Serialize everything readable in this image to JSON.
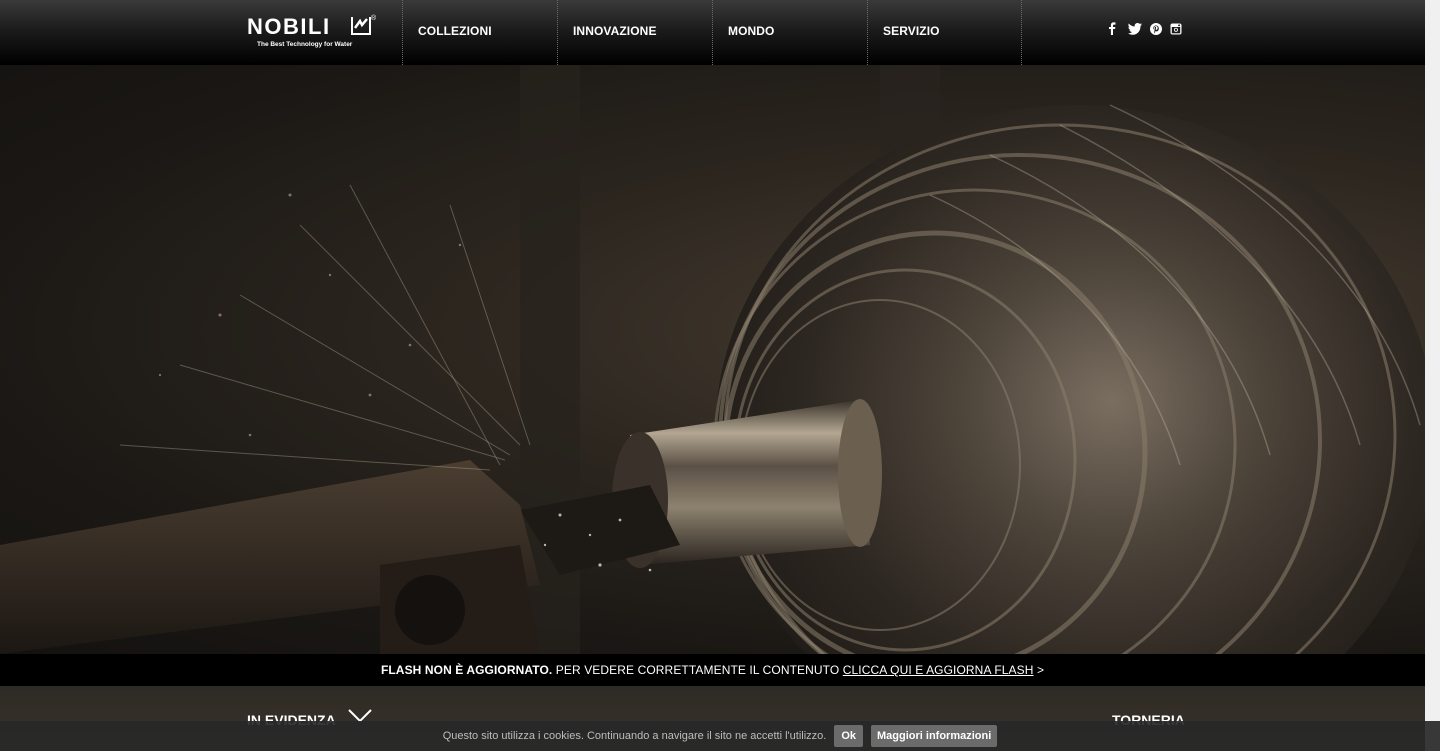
{
  "header": {
    "logo": {
      "wordmark": "NOBILI",
      "registered": "®",
      "tagline": "The Best Technology for Water"
    },
    "nav": [
      {
        "label": "COLLEZIONI"
      },
      {
        "label": "INNOVAZIONE"
      },
      {
        "label": "MONDO"
      },
      {
        "label": "SERVIZIO"
      }
    ],
    "social_icons": [
      "facebook-icon",
      "twitter-icon",
      "pinterest-icon",
      "instagram-icon"
    ]
  },
  "flash_notice": {
    "bold": "FLASH NON È AGGIORNATO.",
    "text": " PER VEDERE CORRETTAMENTE IL CONTENUTO ",
    "link": "CLICCA QUI E AGGIORNA FLASH",
    "arrow": " >"
  },
  "lower": {
    "in_evidenza": "IN EVIDENZA",
    "torneria": "TORNERIA"
  },
  "cookie": {
    "text": "Questo sito utilizza i cookies. Continuando a navigare il sito ne accetti l'utilizzo.",
    "ok_label": "Ok",
    "more_label": "Maggiori informazioni"
  }
}
